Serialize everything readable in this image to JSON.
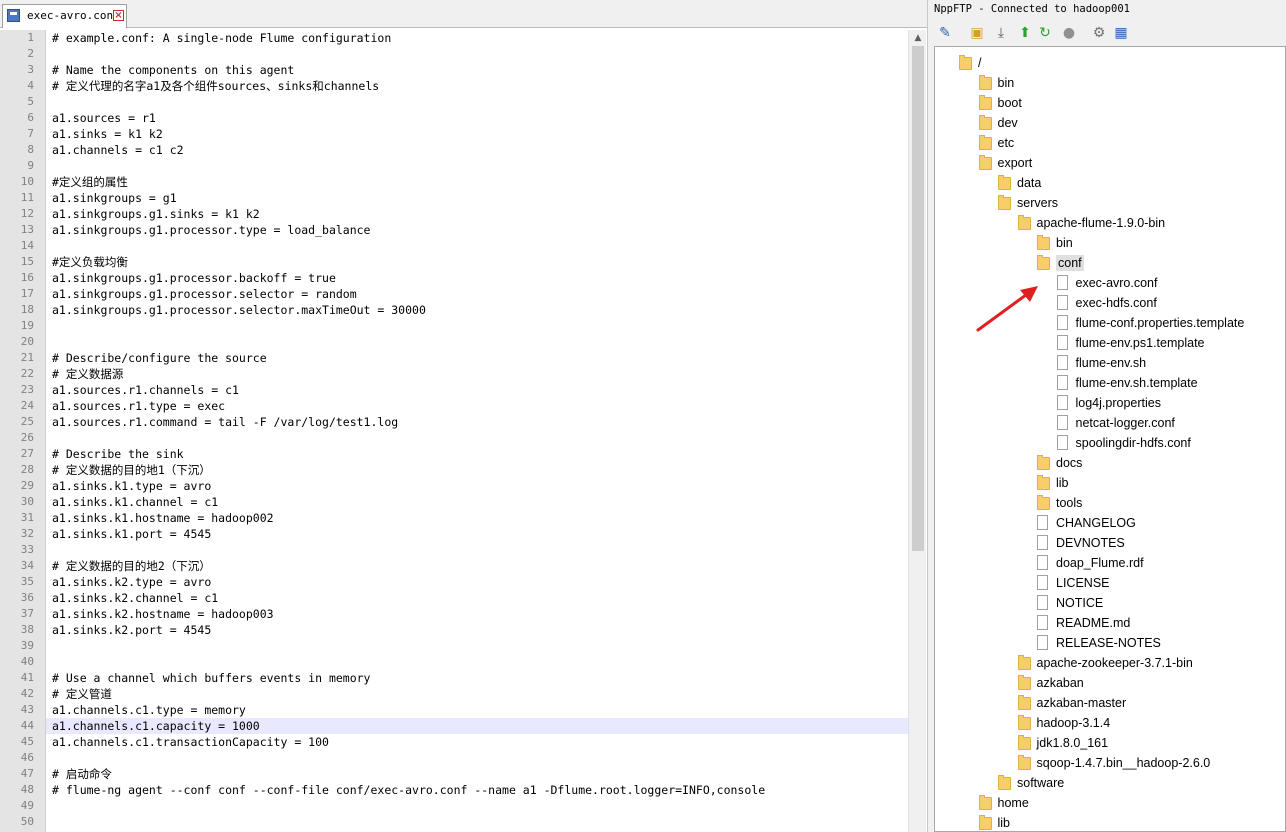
{
  "editor": {
    "tab_title": "exec-avro.conf",
    "highlighted_line": 44,
    "lines": [
      "# example.conf: A single-node Flume configuration",
      "",
      "# Name the components on this agent",
      "# 定义代理的名字a1及各个组件sources、sinks和channels",
      "",
      "a1.sources = r1",
      "a1.sinks = k1 k2",
      "a1.channels = c1 c2",
      "",
      "#定义组的属性",
      "a1.sinkgroups = g1",
      "a1.sinkgroups.g1.sinks = k1 k2",
      "a1.sinkgroups.g1.processor.type = load_balance",
      "",
      "#定义负载均衡",
      "a1.sinkgroups.g1.processor.backoff = true",
      "a1.sinkgroups.g1.processor.selector = random",
      "a1.sinkgroups.g1.processor.selector.maxTimeOut = 30000",
      "",
      "",
      "# Describe/configure the source",
      "# 定义数据源",
      "a1.sources.r1.channels = c1",
      "a1.sources.r1.type = exec",
      "a1.sources.r1.command = tail -F /var/log/test1.log",
      "",
      "# Describe the sink",
      "# 定义数据的目的地1（下沉）",
      "a1.sinks.k1.type = avro",
      "a1.sinks.k1.channel = c1",
      "a1.sinks.k1.hostname = hadoop002",
      "a1.sinks.k1.port = 4545",
      "",
      "# 定义数据的目的地2（下沉）",
      "a1.sinks.k2.type = avro",
      "a1.sinks.k2.channel = c1",
      "a1.sinks.k2.hostname = hadoop003",
      "a1.sinks.k2.port = 4545",
      "",
      "",
      "# Use a channel which buffers events in memory",
      "# 定义管道",
      "a1.channels.c1.type = memory",
      "a1.channels.c1.capacity = 1000",
      "a1.channels.c1.transactionCapacity = 100",
      "",
      "# 启动命令",
      "# flume-ng agent --conf conf --conf-file conf/exec-avro.conf --name a1 -Dflume.root.logger=INFO,console",
      "",
      ""
    ]
  },
  "ftp": {
    "title": "NppFTP - Connected to hadoop001",
    "toolbar_icons": [
      "connect-icon",
      "open-folder-icon",
      "download-icon",
      "upload-icon",
      "refresh-icon",
      "abort-icon",
      "settings-icon",
      "message-window-icon"
    ],
    "tree": [
      {
        "label": "/",
        "type": "folder",
        "depth": 0
      },
      {
        "label": "bin",
        "type": "folder",
        "depth": 1
      },
      {
        "label": "boot",
        "type": "folder",
        "depth": 1
      },
      {
        "label": "dev",
        "type": "folder",
        "depth": 1
      },
      {
        "label": "etc",
        "type": "folder",
        "depth": 1
      },
      {
        "label": "export",
        "type": "folder",
        "depth": 1
      },
      {
        "label": "data",
        "type": "folder",
        "depth": 2
      },
      {
        "label": "servers",
        "type": "folder",
        "depth": 2
      },
      {
        "label": "apache-flume-1.9.0-bin",
        "type": "folder",
        "depth": 3
      },
      {
        "label": "bin",
        "type": "folder",
        "depth": 4
      },
      {
        "label": "conf",
        "type": "folder",
        "depth": 4,
        "selected": true
      },
      {
        "label": "exec-avro.conf",
        "type": "file",
        "depth": 5
      },
      {
        "label": "exec-hdfs.conf",
        "type": "file",
        "depth": 5
      },
      {
        "label": "flume-conf.properties.template",
        "type": "file",
        "depth": 5
      },
      {
        "label": "flume-env.ps1.template",
        "type": "file",
        "depth": 5
      },
      {
        "label": "flume-env.sh",
        "type": "file",
        "depth": 5
      },
      {
        "label": "flume-env.sh.template",
        "type": "file",
        "depth": 5
      },
      {
        "label": "log4j.properties",
        "type": "file",
        "depth": 5
      },
      {
        "label": "netcat-logger.conf",
        "type": "file",
        "depth": 5
      },
      {
        "label": "spoolingdir-hdfs.conf",
        "type": "file",
        "depth": 5
      },
      {
        "label": "docs",
        "type": "folder",
        "depth": 4
      },
      {
        "label": "lib",
        "type": "folder",
        "depth": 4
      },
      {
        "label": "tools",
        "type": "folder",
        "depth": 4
      },
      {
        "label": "CHANGELOG",
        "type": "file",
        "depth": 4
      },
      {
        "label": "DEVNOTES",
        "type": "file",
        "depth": 4
      },
      {
        "label": "doap_Flume.rdf",
        "type": "file",
        "depth": 4
      },
      {
        "label": "LICENSE",
        "type": "file",
        "depth": 4
      },
      {
        "label": "NOTICE",
        "type": "file",
        "depth": 4
      },
      {
        "label": "README.md",
        "type": "file",
        "depth": 4
      },
      {
        "label": "RELEASE-NOTES",
        "type": "file",
        "depth": 4
      },
      {
        "label": "apache-zookeeper-3.7.1-bin",
        "type": "folder",
        "depth": 3
      },
      {
        "label": "azkaban",
        "type": "folder",
        "depth": 3
      },
      {
        "label": "azkaban-master",
        "type": "folder",
        "depth": 3
      },
      {
        "label": "hadoop-3.1.4",
        "type": "folder",
        "depth": 3
      },
      {
        "label": "jdk1.8.0_161",
        "type": "folder",
        "depth": 3
      },
      {
        "label": "sqoop-1.4.7.bin__hadoop-2.6.0",
        "type": "folder",
        "depth": 3
      },
      {
        "label": "software",
        "type": "folder",
        "depth": 2
      },
      {
        "label": "home",
        "type": "folder",
        "depth": 1
      },
      {
        "label": "lib",
        "type": "folder",
        "depth": 1
      }
    ]
  },
  "colors": {
    "annotation_arrow": "#e02020",
    "folder": "#f6cf6a",
    "line_highlight": "#e8e8ff"
  }
}
